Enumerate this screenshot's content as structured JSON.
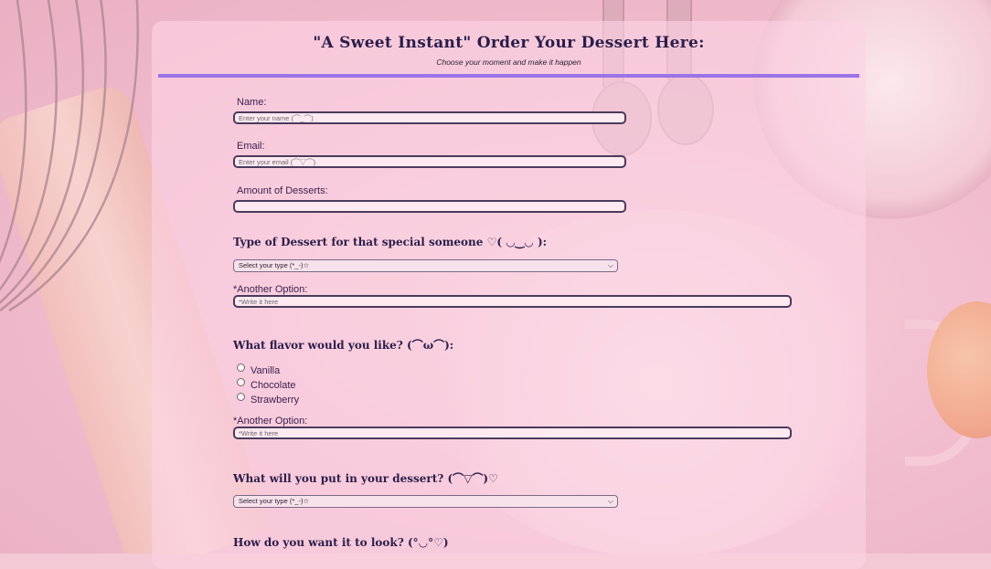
{
  "form": {
    "title": "\"A Sweet Instant\" Order Your Dessert Here:",
    "subtitle": "Choose your moment and make it happen",
    "accent_color": "#9a73e8",
    "name": {
      "label": "Name:",
      "placeholder": "Enter your name (⌒_⌒)",
      "value": ""
    },
    "email": {
      "label": "Email:",
      "placeholder": "Enter your email (⌒▽⌒)",
      "value": ""
    },
    "amount": {
      "label": "Amount of Desserts:",
      "placeholder": "",
      "value": ""
    },
    "dessert_type": {
      "question": "Type of Dessert for that special someone ♡( ◡‿◡ ):",
      "selected": "Select your type (*_-)☆",
      "other_label": "*Another Option:",
      "other_placeholder": "*Write it here"
    },
    "flavor": {
      "question": "What flavor would you like? (⌒ω⌒):",
      "options": [
        "Vanilla",
        "Chocolate",
        "Strawberry"
      ],
      "other_label": "*Another Option:",
      "other_placeholder": "*Write it here"
    },
    "filling": {
      "question": "What will you put in your dessert? (⌒▽⌒)♡",
      "selected": "Select your type (*_-)☆"
    },
    "look": {
      "question": "How do you want it to look? (°◡°♡)"
    }
  }
}
